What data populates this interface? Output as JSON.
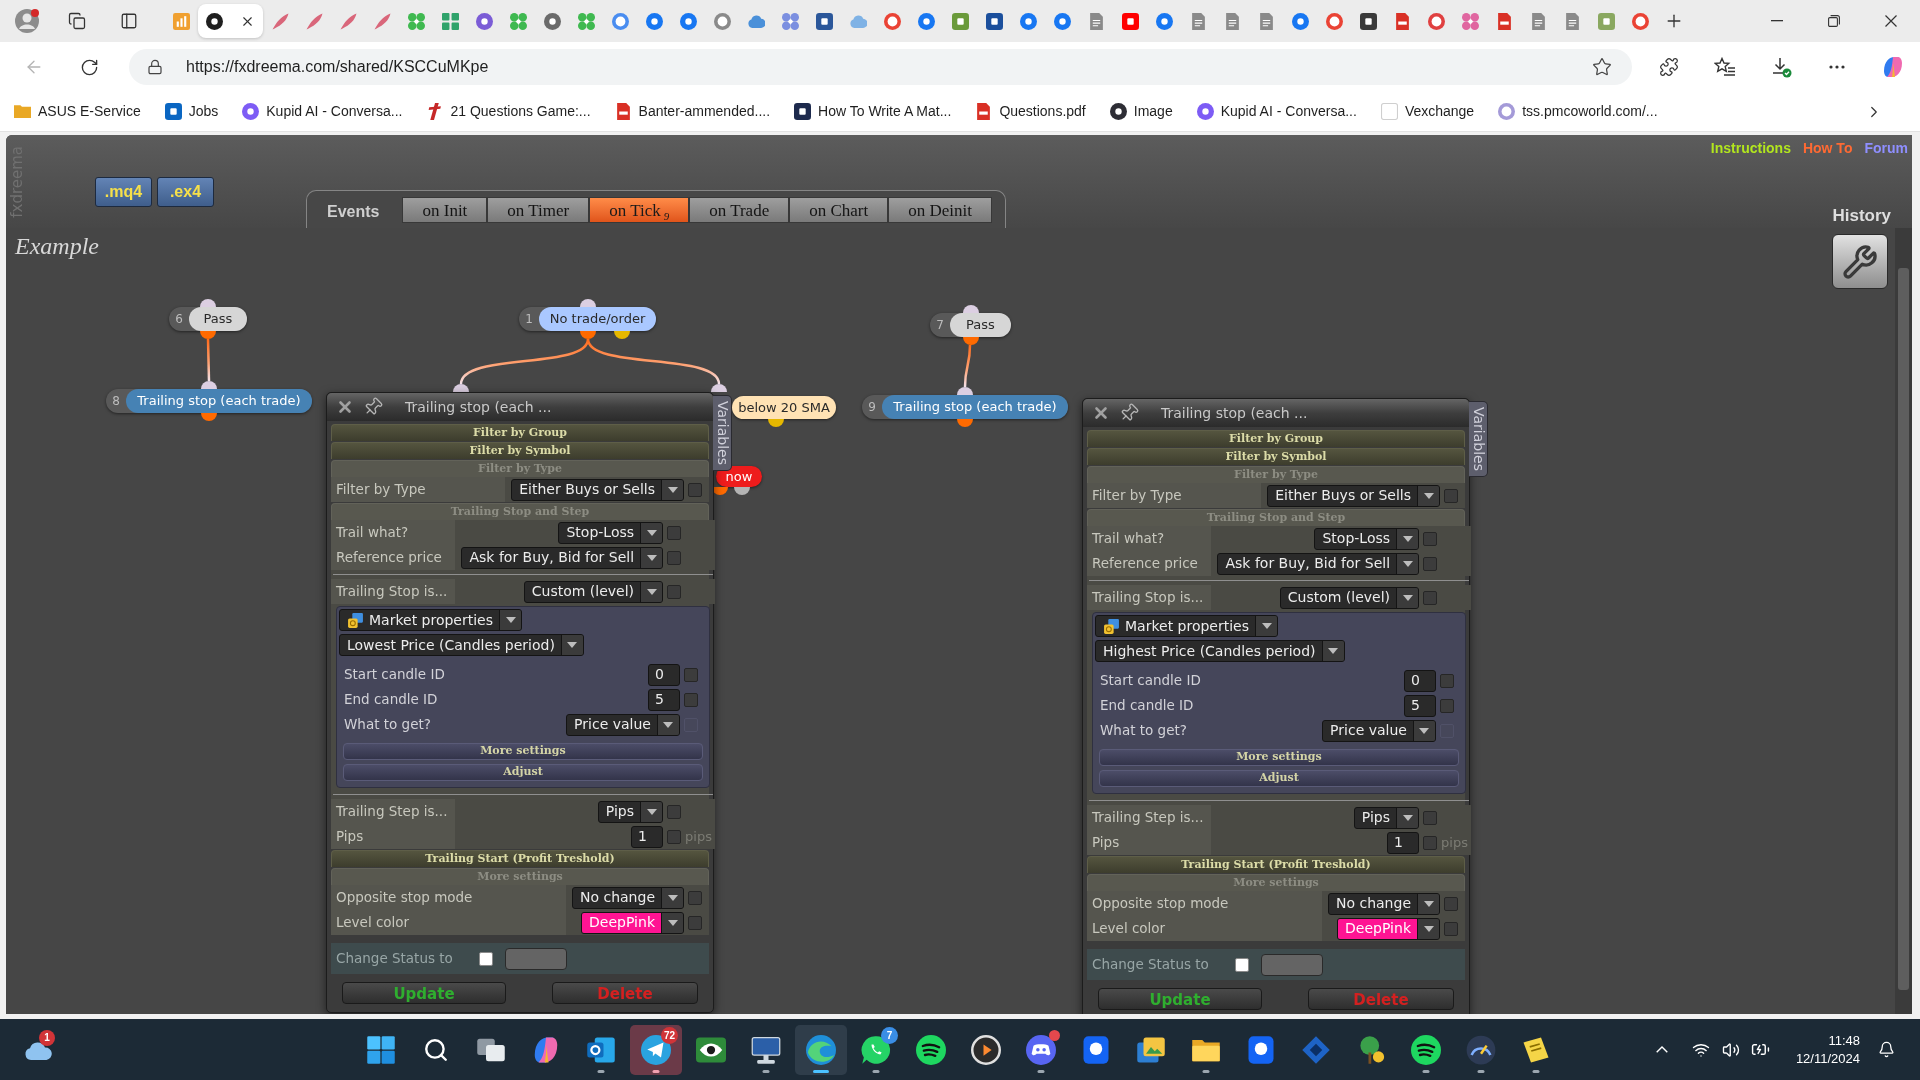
{
  "browser": {
    "tabs": [
      {
        "kind": "chart",
        "color": "#f0a030",
        "selected": false
      },
      {
        "kind": "disc",
        "color": "#1f1f1f",
        "selected": true
      },
      {
        "kind": "feather",
        "color": "#d9667a",
        "selected": false
      },
      {
        "kind": "feather",
        "color": "#d9667a",
        "selected": false
      },
      {
        "kind": "feather",
        "color": "#d9667a",
        "selected": false
      },
      {
        "kind": "feather",
        "color": "#d9667a",
        "selected": false
      },
      {
        "kind": "cluster",
        "color": "#3fb950",
        "selected": false
      },
      {
        "kind": "grid",
        "color": "#2fa36b",
        "selected": false
      },
      {
        "kind": "disc",
        "color": "#7b5cd6",
        "selected": false
      },
      {
        "kind": "cluster",
        "color": "#3fb950",
        "selected": false
      },
      {
        "kind": "disc",
        "color": "#6a6a6a",
        "selected": false
      },
      {
        "kind": "cluster",
        "color": "#3fb950",
        "selected": false
      },
      {
        "kind": "ring",
        "color": "#4a8df0",
        "selected": false
      },
      {
        "kind": "disc",
        "color": "#1877f2",
        "selected": false
      },
      {
        "kind": "disc",
        "color": "#1877f2",
        "selected": false
      },
      {
        "kind": "ring",
        "color": "#8a8a8a",
        "selected": false
      },
      {
        "kind": "cloud",
        "color": "#4a90d9",
        "selected": false
      },
      {
        "kind": "cluster",
        "color": "#7b8fe0",
        "selected": false
      },
      {
        "kind": "tile",
        "color": "#2b579a",
        "selected": false
      },
      {
        "kind": "cloud",
        "color": "#7fb2e5",
        "selected": false
      },
      {
        "kind": "ring",
        "color": "#ea4335",
        "selected": false
      },
      {
        "kind": "disc",
        "color": "#1877f2",
        "selected": false
      },
      {
        "kind": "tile",
        "color": "#6a9a3a",
        "selected": false
      },
      {
        "kind": "tile",
        "color": "#1b4f9c",
        "selected": false
      },
      {
        "kind": "disc",
        "color": "#1877f2",
        "selected": false
      },
      {
        "kind": "disc",
        "color": "#1877f2",
        "selected": false
      },
      {
        "kind": "doc",
        "color": "#8a8a8a",
        "selected": false
      },
      {
        "kind": "tile",
        "color": "#ff0000",
        "selected": false
      },
      {
        "kind": "disc",
        "color": "#1877f2",
        "selected": false
      },
      {
        "kind": "doc",
        "color": "#8a8a8a",
        "selected": false
      },
      {
        "kind": "doc",
        "color": "#8a8a8a",
        "selected": false
      },
      {
        "kind": "doc",
        "color": "#8a8a8a",
        "selected": false
      },
      {
        "kind": "disc",
        "color": "#1877f2",
        "selected": false
      },
      {
        "kind": "ring",
        "color": "#ea4335",
        "selected": false
      },
      {
        "kind": "tile",
        "color": "#3a3a3a",
        "selected": false
      },
      {
        "kind": "pdf",
        "color": "#d93025",
        "selected": false
      },
      {
        "kind": "ring",
        "color": "#e04040",
        "selected": false
      },
      {
        "kind": "cluster",
        "color": "#e066a0",
        "selected": false
      },
      {
        "kind": "pdf",
        "color": "#d93025",
        "selected": false
      },
      {
        "kind": "doc",
        "color": "#8a8a8a",
        "selected": false
      },
      {
        "kind": "doc",
        "color": "#8a8a8a",
        "selected": false
      },
      {
        "kind": "tile",
        "color": "#8aa860",
        "selected": false
      },
      {
        "kind": "ring",
        "color": "#ea4335",
        "selected": false
      }
    ],
    "nav": [
      {
        "kind": "back",
        "disabled": true
      },
      {
        "kind": "reload",
        "disabled": false
      }
    ],
    "url": "https://fxdreema.com/shared/KSCCuMKpe",
    "bookmarks": [
      {
        "label": "ASUS E-Service",
        "kind": "folder",
        "color": "#e9a825"
      },
      {
        "label": "Jobs",
        "kind": "tile",
        "color": "#0a66c2"
      },
      {
        "label": "Kupid AI - Conversa...",
        "kind": "disc",
        "color": "#7d5cf5"
      },
      {
        "label": "21 Questions Game:...",
        "kind": "slash",
        "color": "#c62828"
      },
      {
        "label": "Banter-ammended....",
        "kind": "pdf",
        "color": "#d93025"
      },
      {
        "label": "How To Write A Mat...",
        "kind": "tile",
        "color": "#1d2a4d"
      },
      {
        "label": "Questions.pdf",
        "kind": "pdf",
        "color": "#d93025"
      },
      {
        "label": "Image",
        "kind": "disc",
        "color": "#2d2d35"
      },
      {
        "label": "Kupid AI - Conversa...",
        "kind": "disc",
        "color": "#7d5cf5"
      },
      {
        "label": "Vexchange",
        "kind": "blank"
      },
      {
        "label": "tss.pmcoworld.com/...",
        "kind": "ring",
        "color": "#a49ad8"
      }
    ]
  },
  "app": {
    "site_name": "fxdreema",
    "file_buttons": [
      ".mq4",
      ".ex4"
    ],
    "events": {
      "label": "Events",
      "tabs": [
        {
          "label": "on Init",
          "selected": false
        },
        {
          "label": "on Timer",
          "selected": false
        },
        {
          "label": "on Tick",
          "count": "9",
          "selected": true
        },
        {
          "label": "on Trade",
          "selected": false
        },
        {
          "label": "on Chart",
          "selected": false
        },
        {
          "label": "on Deinit",
          "selected": false
        }
      ]
    },
    "links": [
      {
        "label": "Instructions",
        "color": "#b2e61e"
      },
      {
        "label": "How To",
        "color": "#ff6a33"
      },
      {
        "label": "Forum",
        "color": "#8f8fff"
      }
    ],
    "history": "History",
    "project": "Example",
    "nodes": [
      {
        "number": "6",
        "label": "Pass",
        "color": "#d6d6d6",
        "pins": [
          {
            "kind": "input",
            "color": "#dccfe2"
          },
          {
            "kind": "output",
            "color": "#ff6a00"
          }
        ]
      },
      {
        "number": "8",
        "label": "Trailing stop (each trade)",
        "color": "#4682b4",
        "pins": [
          {
            "kind": "input",
            "color": "#dccfe2"
          },
          {
            "kind": "output",
            "color": "#ff6a00"
          }
        ]
      },
      {
        "number": "1",
        "label": "No trade/order",
        "color": "#aac8ff",
        "pins": [
          {
            "kind": "input",
            "color": "#dccfe2"
          },
          {
            "kind": "output",
            "color": "#ff6a00"
          },
          {
            "kind": "output",
            "color": "#e6b800"
          }
        ]
      },
      {
        "label": "below 20 SMA",
        "color": "#ffe2b4",
        "pins": [
          {
            "kind": "output",
            "color": "#e6b800"
          }
        ]
      },
      {
        "label": "now",
        "color": "#ee1c1c",
        "pins": [
          {
            "kind": "output",
            "color": "#ff6a00"
          },
          {
            "kind": "output",
            "color": "#b4b4b4"
          }
        ]
      },
      {
        "number": "7",
        "label": "Pass",
        "color": "#d6d6d6",
        "pins": [
          {
            "kind": "input",
            "color": "#dccfe2"
          },
          {
            "kind": "output",
            "color": "#ff6a00"
          }
        ]
      },
      {
        "number": "9",
        "label": "Trailing stop (each trade)",
        "color": "#4682b4",
        "pins": [
          {
            "kind": "input",
            "color": "#dccfe2"
          },
          {
            "kind": "output",
            "color": "#ff6a00"
          }
        ]
      }
    ],
    "panels": [
      {
        "title": "Trailing stop (each ...",
        "side_tab": "Variables",
        "sections": [
          {
            "title": "Filter by Group",
            "expanded": false
          },
          {
            "title": "Filter by Symbol",
            "expanded": false
          },
          {
            "title": "Filter by Type",
            "expanded": true,
            "groups": [
              [
                {
                  "kind": "select",
                  "label": "Filter by Type",
                  "value": "Either Buys or Sells",
                  "checkbox": {
                    "checked": false,
                    "disabled": false
                  }
                }
              ]
            ]
          },
          {
            "title": "Trailing Stop and Step",
            "expanded": true,
            "groups": [
              [
                {
                  "kind": "select",
                  "label": "Trail what?",
                  "value": "Stop-Loss",
                  "checkbox": {
                    "checked": false,
                    "disabled": false
                  }
                },
                {
                  "kind": "select",
                  "label": "Reference price",
                  "value": "Ask for Buy, Bid for Sell",
                  "checkbox": {
                    "checked": false,
                    "disabled": false
                  }
                }
              ],
              [
                {
                  "kind": "select",
                  "label": "Trailing Stop is...",
                  "value": "Custom (level)",
                  "checkbox": {
                    "checked": false,
                    "disabled": false
                  }
                },
                {
                  "kind": "box",
                  "selects": [
                    {
                      "kind": "icon-select",
                      "value": "Market properties"
                    },
                    {
                      "kind": "select",
                      "value": "Lowest Price (Candles period)"
                    }
                  ],
                  "rows": [
                    {
                      "kind": "number",
                      "label": "Start candle ID",
                      "value": "0",
                      "checkbox": {
                        "checked": false,
                        "disabled": false
                      }
                    },
                    {
                      "kind": "number",
                      "label": "End candle ID",
                      "value": "5",
                      "checkbox": {
                        "checked": false,
                        "disabled": false
                      }
                    },
                    {
                      "kind": "select",
                      "label": "What to get?",
                      "value": "Price value",
                      "checkbox": {
                        "checked": false,
                        "disabled": true
                      }
                    }
                  ],
                  "bars": [
                    {
                      "title": "More settings",
                      "expanded": false
                    },
                    {
                      "title": "Adjust",
                      "expanded": false
                    }
                  ]
                }
              ],
              [
                {
                  "kind": "select",
                  "label": "Trailing Step is...",
                  "value": "Pips",
                  "checkbox": {
                    "checked": false,
                    "disabled": false
                  }
                },
                {
                  "kind": "number",
                  "label": "Pips",
                  "value": "1",
                  "unit": "pips",
                  "checkbox": {
                    "checked": false,
                    "disabled": false
                  }
                }
              ]
            ]
          },
          {
            "title": "Trailing Start (Profit Treshold)",
            "expanded": false
          },
          {
            "title": "More settings",
            "expanded": true,
            "groups": [
              [
                {
                  "kind": "select",
                  "label": "Opposite stop mode",
                  "value": "No change",
                  "checkbox": {
                    "checked": false,
                    "disabled": false
                  }
                },
                {
                  "kind": "select",
                  "label": "Level color",
                  "value": "DeepPink",
                  "color": "#ff1493",
                  "checkbox": {
                    "checked": false,
                    "disabled": false
                  }
                }
              ]
            ]
          }
        ],
        "status": {
          "label": "Change Status to",
          "checked": false
        },
        "buttons": [
          {
            "label": "Update",
            "kind": "update"
          },
          {
            "label": "Delete",
            "kind": "delete"
          }
        ]
      },
      {
        "title": "Trailing stop (each ...",
        "side_tab": "Variables",
        "sections": [
          {
            "title": "Filter by Group",
            "expanded": false
          },
          {
            "title": "Filter by Symbol",
            "expanded": false
          },
          {
            "title": "Filter by Type",
            "expanded": true,
            "groups": [
              [
                {
                  "kind": "select",
                  "label": "Filter by Type",
                  "value": "Either Buys or Sells",
                  "checkbox": {
                    "checked": false,
                    "disabled": false
                  }
                }
              ]
            ]
          },
          {
            "title": "Trailing Stop and Step",
            "expanded": true,
            "groups": [
              [
                {
                  "kind": "select",
                  "label": "Trail what?",
                  "value": "Stop-Loss",
                  "checkbox": {
                    "checked": false,
                    "disabled": false
                  }
                },
                {
                  "kind": "select",
                  "label": "Reference price",
                  "value": "Ask for Buy, Bid for Sell",
                  "checkbox": {
                    "checked": false,
                    "disabled": false
                  }
                }
              ],
              [
                {
                  "kind": "select",
                  "label": "Trailing Stop is...",
                  "value": "Custom (level)",
                  "checkbox": {
                    "checked": false,
                    "disabled": false
                  }
                },
                {
                  "kind": "box",
                  "selects": [
                    {
                      "kind": "icon-select",
                      "value": "Market properties"
                    },
                    {
                      "kind": "select",
                      "value": "Highest Price (Candles period)"
                    }
                  ],
                  "rows": [
                    {
                      "kind": "number",
                      "label": "Start candle ID",
                      "value": "0",
                      "checkbox": {
                        "checked": false,
                        "disabled": false
                      }
                    },
                    {
                      "kind": "number",
                      "label": "End candle ID",
                      "value": "5",
                      "checkbox": {
                        "checked": false,
                        "disabled": false
                      }
                    },
                    {
                      "kind": "select",
                      "label": "What to get?",
                      "value": "Price value",
                      "checkbox": {
                        "checked": false,
                        "disabled": true
                      }
                    }
                  ],
                  "bars": [
                    {
                      "title": "More settings",
                      "expanded": false
                    },
                    {
                      "title": "Adjust",
                      "expanded": false
                    }
                  ]
                }
              ],
              [
                {
                  "kind": "select",
                  "label": "Trailing Step is...",
                  "value": "Pips",
                  "checkbox": {
                    "checked": false,
                    "disabled": false
                  }
                },
                {
                  "kind": "number",
                  "label": "Pips",
                  "value": "1",
                  "unit": "pips",
                  "checkbox": {
                    "checked": false,
                    "disabled": false
                  }
                }
              ]
            ]
          },
          {
            "title": "Trailing Start (Profit Treshold)",
            "expanded": false
          },
          {
            "title": "More settings",
            "expanded": true,
            "groups": [
              [
                {
                  "kind": "select",
                  "label": "Opposite stop mode",
                  "value": "No change",
                  "checkbox": {
                    "checked": false,
                    "disabled": false
                  }
                },
                {
                  "kind": "select",
                  "label": "Level color",
                  "value": "DeepPink",
                  "color": "#ff1493",
                  "checkbox": {
                    "checked": false,
                    "disabled": false
                  }
                }
              ]
            ]
          }
        ],
        "status": {
          "label": "Change Status to",
          "checked": false
        },
        "buttons": [
          {
            "label": "Update",
            "kind": "update"
          },
          {
            "label": "Delete",
            "kind": "delete"
          }
        ]
      }
    ]
  },
  "taskbar": {
    "weather_badge": "1",
    "apps": [
      {
        "kind": "start",
        "running": false,
        "selected": false,
        "flashing": false,
        "alert": false
      },
      {
        "kind": "search",
        "running": false,
        "selected": false,
        "flashing": false,
        "alert": false
      },
      {
        "kind": "taskview",
        "running": false,
        "selected": false,
        "flashing": false,
        "alert": false
      },
      {
        "kind": "copilot",
        "running": false,
        "selected": false,
        "flashing": false,
        "alert": false
      },
      {
        "kind": "mail",
        "running": true,
        "selected": false,
        "flashing": false,
        "alert": false
      },
      {
        "kind": "plane",
        "running": true,
        "selected": false,
        "flashing": true,
        "alert": false,
        "badge": {
          "text": "72",
          "color": "#d13438"
        }
      },
      {
        "kind": "eye",
        "running": false,
        "selected": false,
        "flashing": false,
        "alert": false
      },
      {
        "kind": "monitor",
        "running": true,
        "selected": false,
        "flashing": false,
        "alert": false
      },
      {
        "kind": "browser",
        "running": true,
        "selected": true,
        "flashing": false,
        "alert": false
      },
      {
        "kind": "chat",
        "running": true,
        "selected": false,
        "flashing": false,
        "alert": false,
        "badge": {
          "text": "7",
          "color": "#3a8ee6"
        }
      },
      {
        "kind": "music",
        "running": false,
        "selected": false,
        "flashing": false,
        "alert": false
      },
      {
        "kind": "play",
        "running": false,
        "selected": false,
        "flashing": false,
        "alert": false
      },
      {
        "kind": "gamepad",
        "running": true,
        "selected": false,
        "flashing": false,
        "alert": true
      },
      {
        "kind": "tile",
        "running": false,
        "selected": false,
        "flashing": false,
        "alert": false
      },
      {
        "kind": "photos",
        "running": false,
        "selected": false,
        "flashing": false,
        "alert": false
      },
      {
        "kind": "folder",
        "running": true,
        "selected": false,
        "flashing": false,
        "alert": false
      },
      {
        "kind": "tile",
        "running": false,
        "selected": false,
        "flashing": false,
        "alert": false
      },
      {
        "kind": "diamond",
        "running": false,
        "selected": false,
        "flashing": false,
        "alert": false
      },
      {
        "kind": "tree",
        "running": false,
        "selected": false,
        "flashing": false,
        "alert": false
      },
      {
        "kind": "music",
        "running": true,
        "selected": false,
        "flashing": false,
        "alert": false
      },
      {
        "kind": "gauge",
        "running": true,
        "selected": false,
        "flashing": false,
        "alert": false
      },
      {
        "kind": "note",
        "running": true,
        "selected": false,
        "flashing": false,
        "alert": false
      }
    ],
    "time": "11:48",
    "date": "12/11/2024"
  }
}
